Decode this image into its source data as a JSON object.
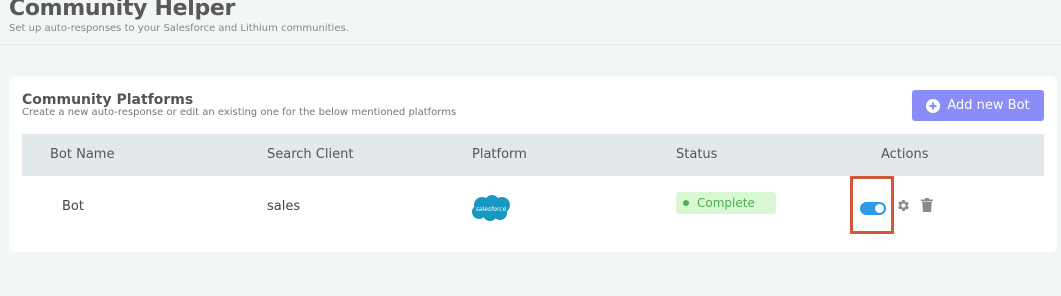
{
  "header": {
    "title": "Community Helper",
    "subtitle": "Set up auto-responses to your Salesforce and Lithium communities."
  },
  "card": {
    "title": "Community Platforms",
    "subtitle": "Create a new auto-response or edit an existing one for the below mentioned platforms",
    "add_button_label": "Add new Bot"
  },
  "table": {
    "columns": [
      "Bot Name",
      "Search Client",
      "Platform",
      "Status",
      "Actions"
    ],
    "rows": [
      {
        "bot_name": "Bot",
        "search_client": "sales",
        "platform": "salesforce",
        "status": "Complete",
        "enabled": true
      }
    ]
  },
  "colors": {
    "accent": "#8a8cf7",
    "status_complete": "#4caf50",
    "toggle_on": "#2d9ae8",
    "salesforce": "#1798c1",
    "highlight": "#d1593b"
  },
  "icons": [
    "plus-circle-icon",
    "salesforce-logo",
    "toggle-switch",
    "gear-icon",
    "trash-icon"
  ]
}
